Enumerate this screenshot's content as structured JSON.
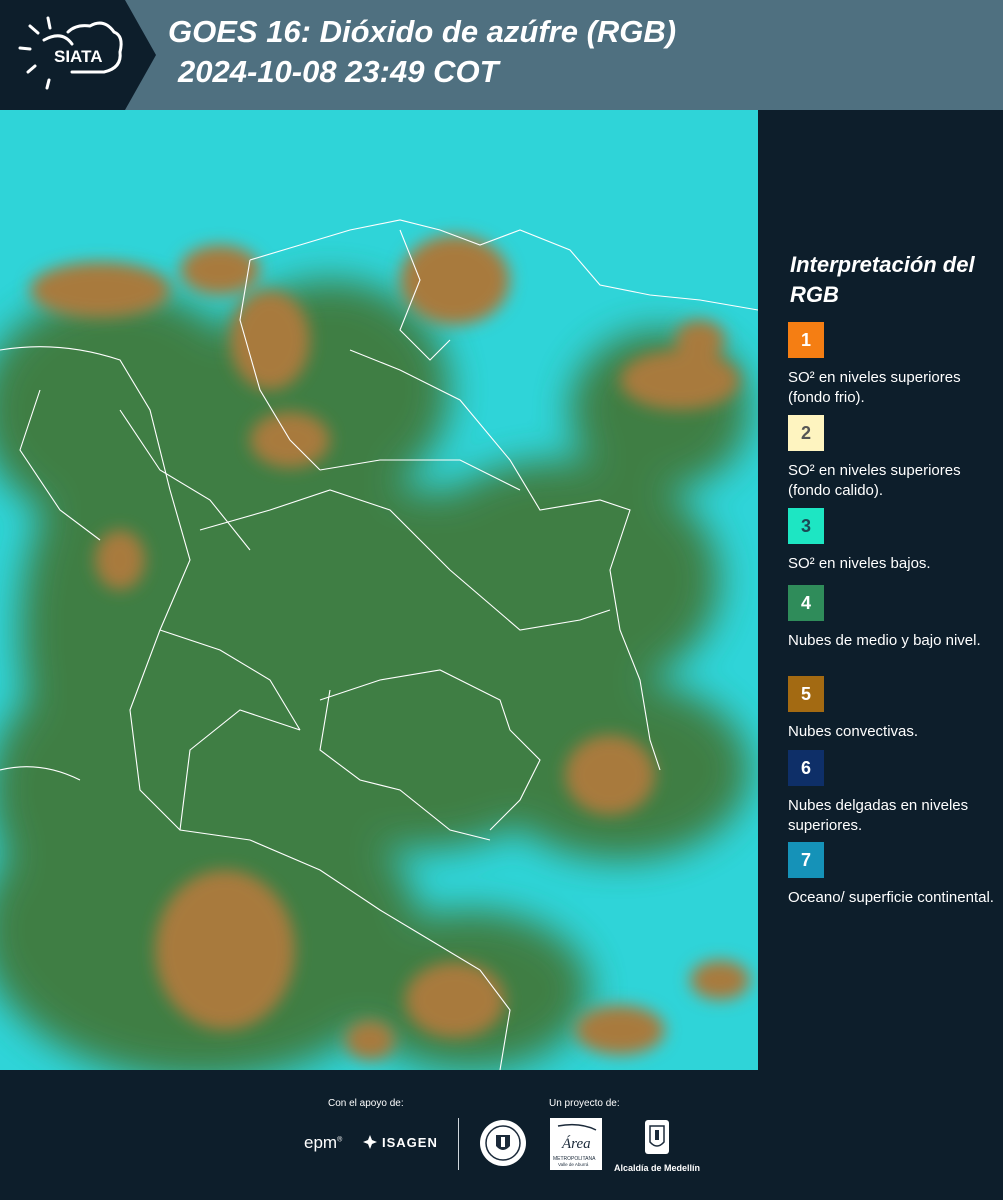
{
  "header": {
    "logo_text": "SIATA",
    "title_line1": "GOES 16: Dióxido de azúfre (RGB)",
    "title_line2": "2024-10-08 23:49 COT",
    "background_color": "#4f7080",
    "panel_color": "#0d1e2b"
  },
  "map": {
    "ocean_color": "#2fd4d8",
    "cloud_green": "#3f7a3c",
    "cloud_orange": "#a87a3c",
    "border_color": "#ffffff"
  },
  "legend": {
    "title": "Interpretación del RGB",
    "items": [
      {
        "number": "1",
        "label": "SO² en niveles superiores (fondo frio).",
        "color": "#f57e13",
        "text_color": "#ffffff"
      },
      {
        "number": "2",
        "label": "SO² en niveles superiores (fondo calido).",
        "color": "#fef4c0",
        "text_color": "#555555"
      },
      {
        "number": "3",
        "label": "SO² en niveles bajos.",
        "color": "#1de6c3",
        "text_color": "#1b4a55"
      },
      {
        "number": "4",
        "label": "Nubes de medio y bajo nivel.",
        "color": "#2f8c5a",
        "text_color": "#ffffff"
      },
      {
        "number": "5",
        "label": "Nubes convectivas.",
        "color": "#a36a12",
        "text_color": "#ffffff"
      },
      {
        "number": "6",
        "label": "Nubes delgadas en niveles superiores.",
        "color": "#0e2f68",
        "text_color": "#ffffff"
      },
      {
        "number": "7",
        "label": "Oceano/ superficie continental.",
        "color": "#1592b8",
        "text_color": "#ffffff"
      }
    ]
  },
  "footer": {
    "support_caption": "Con el apoyo de:",
    "project_caption": "Un proyecto de:",
    "epm": "epm",
    "isagen": "ISAGEN",
    "alcaldia": "Alcaldía de Medellín",
    "area_logo_word": "Área",
    "area_logo_sub1": "METROPOLITANA",
    "area_logo_sub2": "Valle de Aburrá"
  }
}
